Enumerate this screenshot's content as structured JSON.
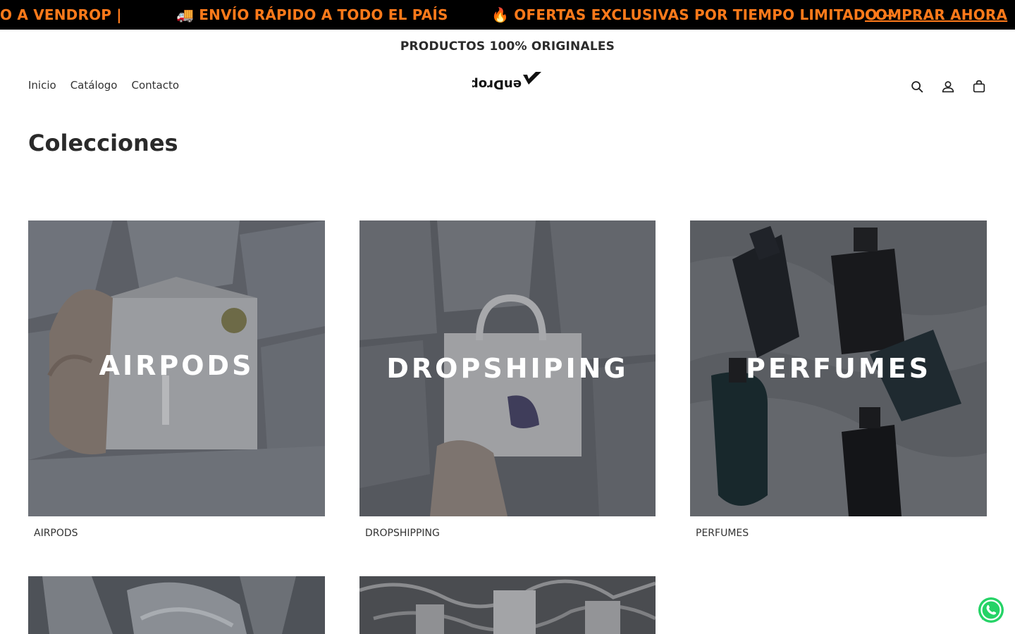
{
  "announcement": {
    "item1": "O A VENDROP |",
    "item2": "🚚 ENVÍO RÁPIDO A TODO EL PAÍS",
    "item3": "🔥 OFERTAS EXCLUSIVAS POR TIEMPO LIMITADO —",
    "item3_link": "COMPRAR AHORA",
    "color": "#ff7a1a"
  },
  "subbar": {
    "text": "PRODUCTOS 100% ORIGINALES"
  },
  "nav": {
    "items": [
      "Inicio",
      "Catálogo",
      "Contacto"
    ]
  },
  "logo": {
    "text": "VenDrop"
  },
  "header_icons": [
    "search-icon",
    "account-icon",
    "cart-icon"
  ],
  "page": {
    "title": "Colecciones"
  },
  "collections": [
    {
      "overlay": "AIRPODS",
      "label": "AIRPODS"
    },
    {
      "overlay": "DROPSHIPING",
      "label": "DROPSHIPPING"
    },
    {
      "overlay": "PERFUMES",
      "label": "PERFUMES"
    },
    {
      "overlay": "",
      "label": ""
    },
    {
      "overlay": "",
      "label": ""
    }
  ],
  "whatsapp": {
    "icon": "whatsapp-icon",
    "color": "#25d366"
  }
}
